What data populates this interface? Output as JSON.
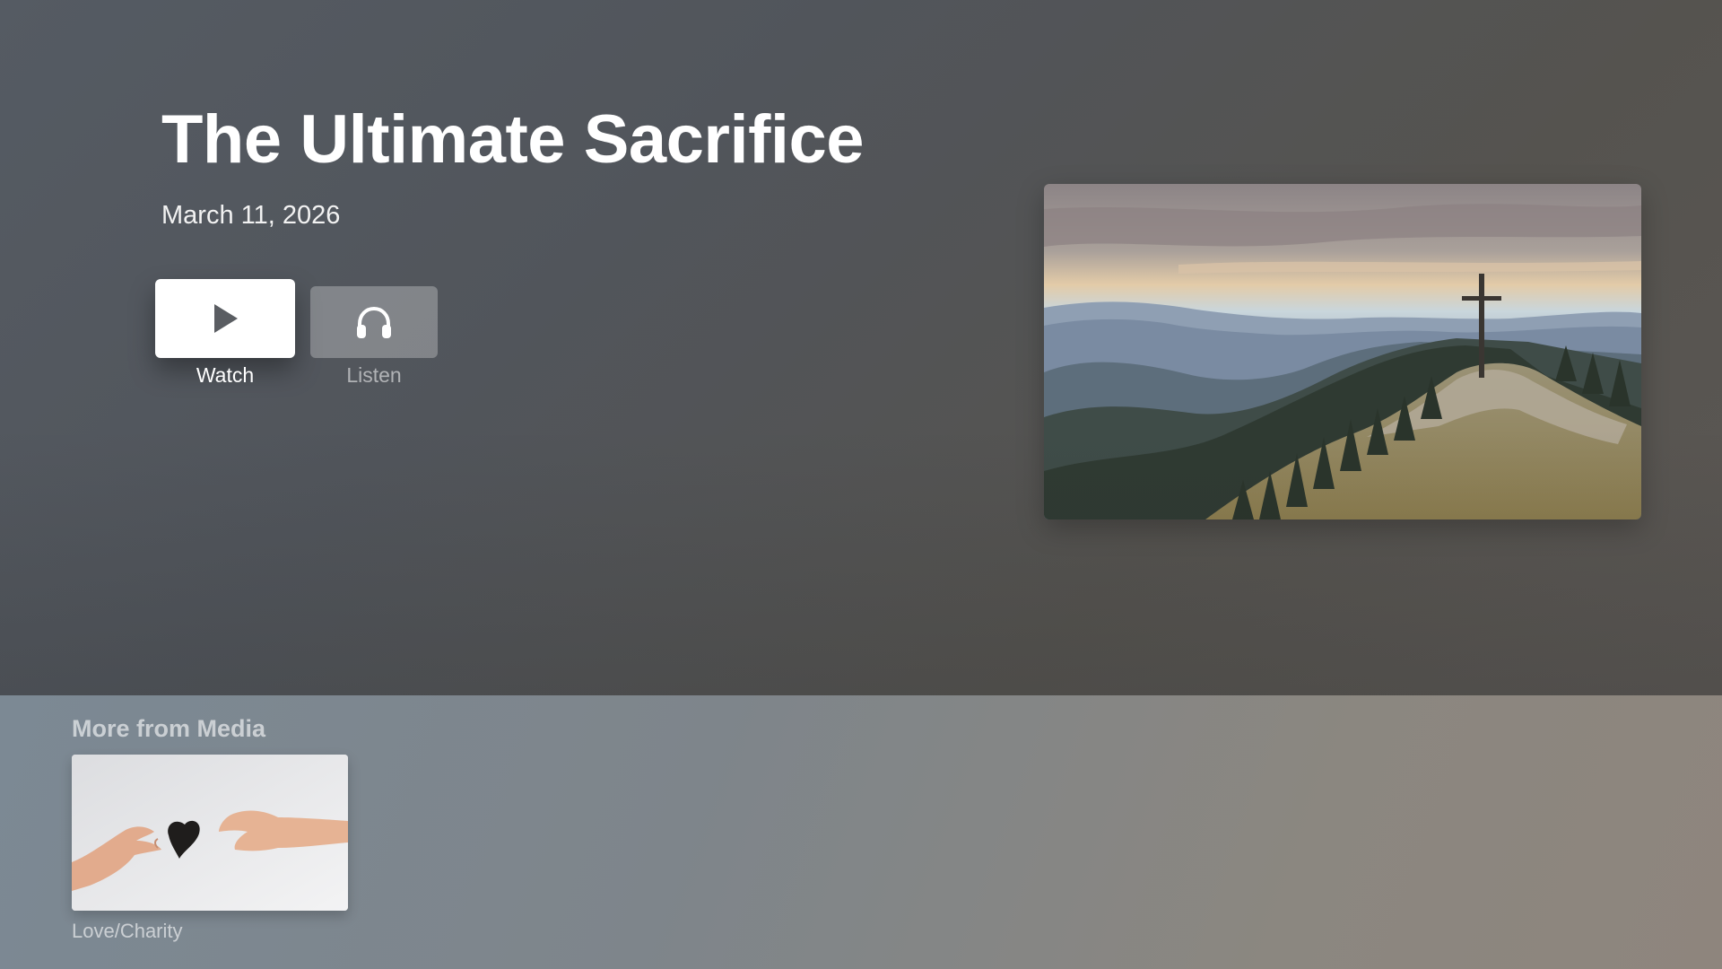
{
  "detail": {
    "title": "The Ultimate Sacrifice",
    "date": "March 11, 2026",
    "image_icon": "mountain-cross-image"
  },
  "actions": {
    "watch": {
      "label": "Watch",
      "icon": "play-icon"
    },
    "listen": {
      "label": "Listen",
      "icon": "headphones-icon"
    }
  },
  "shelf": {
    "title": "More from Media",
    "items": [
      {
        "label": "Love/Charity",
        "icon": "hands-heart-image"
      }
    ]
  },
  "colors": {
    "hero_background": "#53575d",
    "shelf_background": "#838780",
    "button_focused": "#ffffff",
    "button_unfocused": "#8a8d92"
  }
}
